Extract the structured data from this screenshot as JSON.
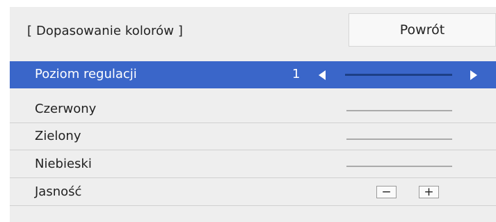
{
  "header": {
    "title": "[ Dopasowanie kolorów ]",
    "back_label": "Powrót"
  },
  "rows": [
    {
      "label": "Poziom regulacji",
      "value": "1",
      "selected": true
    },
    {
      "label": "Czerwony"
    },
    {
      "label": "Zielony"
    },
    {
      "label": "Niebieski"
    },
    {
      "label": "Jasność",
      "minus": "−",
      "plus": "+"
    }
  ],
  "colors": {
    "selection": "#3a66c9",
    "panel": "#eeeeee"
  },
  "icons": {
    "left": "arrow-left-icon",
    "right": "arrow-right-icon"
  }
}
